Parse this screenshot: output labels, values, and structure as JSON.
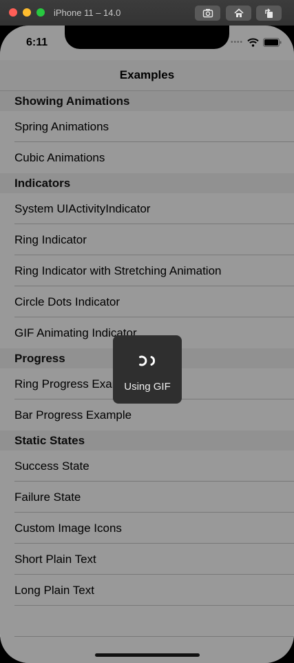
{
  "simulator": {
    "title": "iPhone 11 – 14.0"
  },
  "status_bar": {
    "time": "6:11"
  },
  "navbar": {
    "title": "Examples"
  },
  "sections": [
    {
      "header": "Showing Animations",
      "rows": [
        "Spring Animations",
        "Cubic Animations"
      ]
    },
    {
      "header": "Indicators",
      "rows": [
        "System UIActivityIndicator",
        "Ring Indicator",
        "Ring Indicator with Stretching Animation",
        "Circle Dots Indicator",
        "GIF Animating Indicator"
      ]
    },
    {
      "header": "Progress",
      "rows": [
        "Ring Progress Example",
        "Bar Progress Example"
      ]
    },
    {
      "header": "Static States",
      "rows": [
        "Success State",
        "Failure State",
        "Custom Image Icons",
        "Short Plain Text",
        "Long Plain Text"
      ]
    }
  ],
  "hud": {
    "label": "Using GIF"
  },
  "colors": {
    "close": "#ff5f57",
    "minimize": "#febc2e",
    "maximize": "#28c840",
    "hud_bg": "#2f2f2f"
  }
}
